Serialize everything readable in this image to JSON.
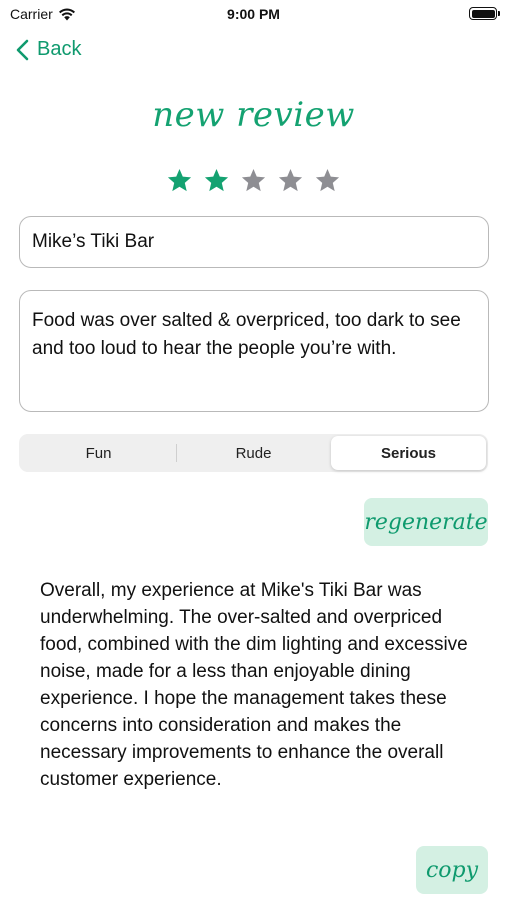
{
  "status_bar": {
    "carrier": "Carrier",
    "time": "9:00 PM"
  },
  "nav": {
    "back_label": "Back"
  },
  "page": {
    "title": "new review"
  },
  "rating": {
    "value": 2,
    "max": 5,
    "filled_color": "#14a271",
    "empty_color": "#8e8e93"
  },
  "form": {
    "place_name": "Mike’s Tiki Bar",
    "review_text": "Food was over salted & overpriced, too dark to see and too loud to hear the people you’re with."
  },
  "tone": {
    "options": [
      "Fun",
      "Rude",
      "Serious"
    ],
    "selected": "Serious"
  },
  "actions": {
    "regenerate_label": "regenerate",
    "copy_label": "copy"
  },
  "output": {
    "text": "Overall, my experience at Mike's Tiki Bar was underwhelming. The over-salted and overpriced food, combined with the dim lighting and excessive noise, made for a less than enjoyable dining experience. I hope the management takes these concerns into consideration and makes the necessary improvements to enhance the overall customer experience."
  },
  "colors": {
    "accent": "#14a271",
    "button_bg": "#d4f0e3"
  }
}
